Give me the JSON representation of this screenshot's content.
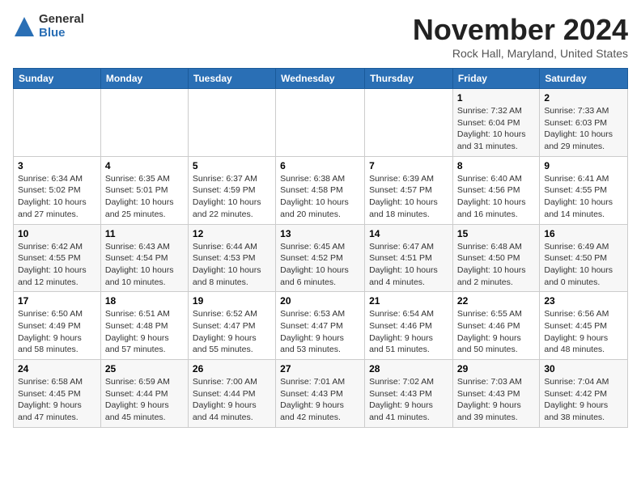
{
  "logo": {
    "general": "General",
    "blue": "Blue"
  },
  "title": "November 2024",
  "subtitle": "Rock Hall, Maryland, United States",
  "days_of_week": [
    "Sunday",
    "Monday",
    "Tuesday",
    "Wednesday",
    "Thursday",
    "Friday",
    "Saturday"
  ],
  "weeks": [
    [
      {
        "day": "",
        "info": ""
      },
      {
        "day": "",
        "info": ""
      },
      {
        "day": "",
        "info": ""
      },
      {
        "day": "",
        "info": ""
      },
      {
        "day": "",
        "info": ""
      },
      {
        "day": "1",
        "info": "Sunrise: 7:32 AM\nSunset: 6:04 PM\nDaylight: 10 hours and 31 minutes."
      },
      {
        "day": "2",
        "info": "Sunrise: 7:33 AM\nSunset: 6:03 PM\nDaylight: 10 hours and 29 minutes."
      }
    ],
    [
      {
        "day": "3",
        "info": "Sunrise: 6:34 AM\nSunset: 5:02 PM\nDaylight: 10 hours and 27 minutes."
      },
      {
        "day": "4",
        "info": "Sunrise: 6:35 AM\nSunset: 5:01 PM\nDaylight: 10 hours and 25 minutes."
      },
      {
        "day": "5",
        "info": "Sunrise: 6:37 AM\nSunset: 4:59 PM\nDaylight: 10 hours and 22 minutes."
      },
      {
        "day": "6",
        "info": "Sunrise: 6:38 AM\nSunset: 4:58 PM\nDaylight: 10 hours and 20 minutes."
      },
      {
        "day": "7",
        "info": "Sunrise: 6:39 AM\nSunset: 4:57 PM\nDaylight: 10 hours and 18 minutes."
      },
      {
        "day": "8",
        "info": "Sunrise: 6:40 AM\nSunset: 4:56 PM\nDaylight: 10 hours and 16 minutes."
      },
      {
        "day": "9",
        "info": "Sunrise: 6:41 AM\nSunset: 4:55 PM\nDaylight: 10 hours and 14 minutes."
      }
    ],
    [
      {
        "day": "10",
        "info": "Sunrise: 6:42 AM\nSunset: 4:55 PM\nDaylight: 10 hours and 12 minutes."
      },
      {
        "day": "11",
        "info": "Sunrise: 6:43 AM\nSunset: 4:54 PM\nDaylight: 10 hours and 10 minutes."
      },
      {
        "day": "12",
        "info": "Sunrise: 6:44 AM\nSunset: 4:53 PM\nDaylight: 10 hours and 8 minutes."
      },
      {
        "day": "13",
        "info": "Sunrise: 6:45 AM\nSunset: 4:52 PM\nDaylight: 10 hours and 6 minutes."
      },
      {
        "day": "14",
        "info": "Sunrise: 6:47 AM\nSunset: 4:51 PM\nDaylight: 10 hours and 4 minutes."
      },
      {
        "day": "15",
        "info": "Sunrise: 6:48 AM\nSunset: 4:50 PM\nDaylight: 10 hours and 2 minutes."
      },
      {
        "day": "16",
        "info": "Sunrise: 6:49 AM\nSunset: 4:50 PM\nDaylight: 10 hours and 0 minutes."
      }
    ],
    [
      {
        "day": "17",
        "info": "Sunrise: 6:50 AM\nSunset: 4:49 PM\nDaylight: 9 hours and 58 minutes."
      },
      {
        "day": "18",
        "info": "Sunrise: 6:51 AM\nSunset: 4:48 PM\nDaylight: 9 hours and 57 minutes."
      },
      {
        "day": "19",
        "info": "Sunrise: 6:52 AM\nSunset: 4:47 PM\nDaylight: 9 hours and 55 minutes."
      },
      {
        "day": "20",
        "info": "Sunrise: 6:53 AM\nSunset: 4:47 PM\nDaylight: 9 hours and 53 minutes."
      },
      {
        "day": "21",
        "info": "Sunrise: 6:54 AM\nSunset: 4:46 PM\nDaylight: 9 hours and 51 minutes."
      },
      {
        "day": "22",
        "info": "Sunrise: 6:55 AM\nSunset: 4:46 PM\nDaylight: 9 hours and 50 minutes."
      },
      {
        "day": "23",
        "info": "Sunrise: 6:56 AM\nSunset: 4:45 PM\nDaylight: 9 hours and 48 minutes."
      }
    ],
    [
      {
        "day": "24",
        "info": "Sunrise: 6:58 AM\nSunset: 4:45 PM\nDaylight: 9 hours and 47 minutes."
      },
      {
        "day": "25",
        "info": "Sunrise: 6:59 AM\nSunset: 4:44 PM\nDaylight: 9 hours and 45 minutes."
      },
      {
        "day": "26",
        "info": "Sunrise: 7:00 AM\nSunset: 4:44 PM\nDaylight: 9 hours and 44 minutes."
      },
      {
        "day": "27",
        "info": "Sunrise: 7:01 AM\nSunset: 4:43 PM\nDaylight: 9 hours and 42 minutes."
      },
      {
        "day": "28",
        "info": "Sunrise: 7:02 AM\nSunset: 4:43 PM\nDaylight: 9 hours and 41 minutes."
      },
      {
        "day": "29",
        "info": "Sunrise: 7:03 AM\nSunset: 4:43 PM\nDaylight: 9 hours and 39 minutes."
      },
      {
        "day": "30",
        "info": "Sunrise: 7:04 AM\nSunset: 4:42 PM\nDaylight: 9 hours and 38 minutes."
      }
    ]
  ]
}
